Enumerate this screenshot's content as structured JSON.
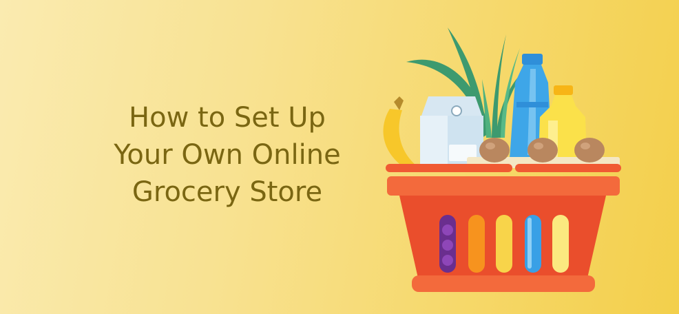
{
  "banner": {
    "title_lines": [
      "How to Set Up",
      "Your Own Online",
      "Grocery Store"
    ],
    "illustration": "grocery-basket-illustration",
    "colors": {
      "background_light": "#faebb0",
      "background_dark": "#f3cf4b",
      "title_text": "#7a6612",
      "basket": "#f05a33",
      "bottle": "#3ea6e8",
      "oil": "#fbe14a",
      "milk": "#e6f1f8",
      "leaves": "#3d9a6f"
    }
  }
}
